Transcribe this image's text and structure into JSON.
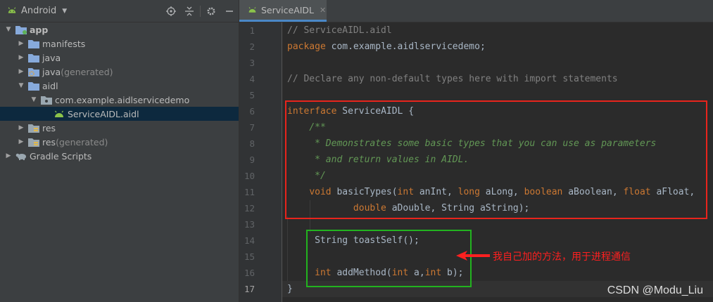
{
  "project_panel": {
    "view_label": "Android",
    "tree": [
      {
        "label": "app",
        "suffix": "",
        "depth": 0,
        "expanded": true,
        "icon": "module-folder-icon",
        "bold": true
      },
      {
        "label": "manifests",
        "suffix": "",
        "depth": 1,
        "expanded": false,
        "icon": "folder-icon"
      },
      {
        "label": "java",
        "suffix": "",
        "depth": 1,
        "expanded": false,
        "icon": "folder-icon"
      },
      {
        "label": "java",
        "suffix": " (generated)",
        "depth": 1,
        "expanded": false,
        "icon": "generated-folder-icon"
      },
      {
        "label": "aidl",
        "suffix": "",
        "depth": 1,
        "expanded": true,
        "icon": "folder-icon"
      },
      {
        "label": "com.example.aidlservicedemo",
        "suffix": "",
        "depth": 2,
        "expanded": true,
        "icon": "package-icon"
      },
      {
        "label": "ServiceAIDL.aidl",
        "suffix": "",
        "depth": 3,
        "expanded": null,
        "icon": "android-file-icon",
        "selected": true
      },
      {
        "label": "res",
        "suffix": "",
        "depth": 1,
        "expanded": false,
        "icon": "resource-folder-icon"
      },
      {
        "label": "res",
        "suffix": " (generated)",
        "depth": 1,
        "expanded": false,
        "icon": "resource-folder-icon"
      },
      {
        "label": "Gradle Scripts",
        "suffix": "",
        "depth": 0,
        "expanded": false,
        "icon": "gradle-icon"
      }
    ]
  },
  "editor": {
    "tab_label": "ServiceAIDL",
    "current_line": 17,
    "lines": [
      [
        {
          "t": "// ServiceAIDL.aidl",
          "c": "cm"
        }
      ],
      [
        {
          "t": "package",
          "c": "kw"
        },
        {
          "t": " com.example.aidlservicedemo;",
          "c": ""
        }
      ],
      [],
      [
        {
          "t": "// Declare any non-default types here with import statements",
          "c": "cm"
        }
      ],
      [],
      [
        {
          "t": "interface",
          "c": "kw"
        },
        {
          "t": " ServiceAIDL {",
          "c": ""
        }
      ],
      [
        {
          "t": "    /**",
          "c": "doc"
        }
      ],
      [
        {
          "t": "     * Demonstrates some basic types that you can use as parameters",
          "c": "doc"
        }
      ],
      [
        {
          "t": "     * and return values in AIDL.",
          "c": "doc"
        }
      ],
      [
        {
          "t": "     */",
          "c": "doc"
        }
      ],
      [
        {
          "t": "    ",
          "c": ""
        },
        {
          "t": "void",
          "c": "kw"
        },
        {
          "t": " basicTypes(",
          "c": ""
        },
        {
          "t": "int",
          "c": "kw"
        },
        {
          "t": " anInt, ",
          "c": ""
        },
        {
          "t": "long",
          "c": "kw"
        },
        {
          "t": " aLong, ",
          "c": ""
        },
        {
          "t": "boolean",
          "c": "kw"
        },
        {
          "t": " aBoolean, ",
          "c": ""
        },
        {
          "t": "float",
          "c": "kw"
        },
        {
          "t": " aFloat,",
          "c": ""
        }
      ],
      [
        {
          "t": "            ",
          "c": ""
        },
        {
          "t": "double",
          "c": "kw"
        },
        {
          "t": " aDouble, String aString);",
          "c": ""
        }
      ],
      [],
      [
        {
          "t": "     String toastSelf();",
          "c": ""
        }
      ],
      [],
      [
        {
          "t": "     ",
          "c": ""
        },
        {
          "t": "int",
          "c": "kw"
        },
        {
          "t": " addMethod(",
          "c": ""
        },
        {
          "t": "int",
          "c": "kw"
        },
        {
          "t": " a,",
          "c": ""
        },
        {
          "t": "int",
          "c": "kw"
        },
        {
          "t": " b);",
          "c": ""
        }
      ],
      [
        {
          "t": "}",
          "c": ""
        }
      ]
    ]
  },
  "annotation": {
    "text": "我自己加的方法，用于进程通信",
    "red_box_color": "#e8241c",
    "green_box_color": "#22b31f",
    "arrow_color": "#ff2020"
  },
  "watermark": "CSDN @Modu_Liu",
  "colors": {
    "keyword": "#cc7832",
    "comment": "#808080",
    "doc_comment": "#629755",
    "plain": "#a9b7c6",
    "selection": "#0d293e",
    "tab_underline": "#4a88c7"
  }
}
